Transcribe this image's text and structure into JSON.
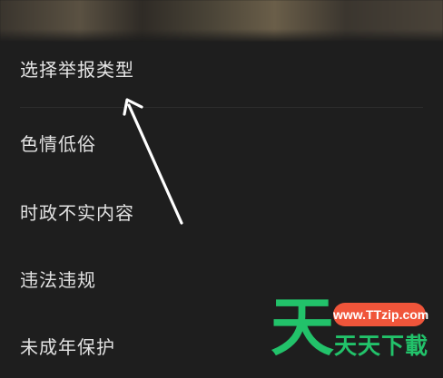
{
  "sheet": {
    "title": "选择举报类型",
    "options": [
      {
        "label": "色情低俗"
      },
      {
        "label": "时政不实内容"
      },
      {
        "label": "违法违规"
      },
      {
        "label": "未成年保护"
      }
    ]
  },
  "watermark": {
    "logo_char": "天",
    "url": "www.TTzip.com",
    "name": "天天下載",
    "colors": {
      "green": "#22c26a",
      "badge": "#f0553a"
    }
  },
  "annotation": {
    "arrow_color": "#ffffff",
    "arrow_icon": "annotation-arrow-icon"
  }
}
